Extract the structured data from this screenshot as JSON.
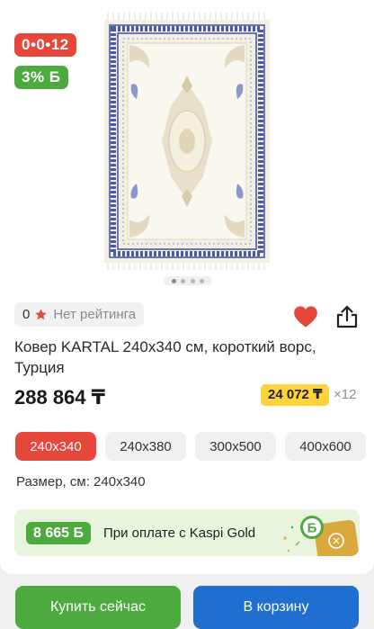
{
  "gallery": {
    "timer_badge": "0•0•12",
    "bonus_badge": "3% Б",
    "slide_count": 4,
    "active_slide": 0
  },
  "rating": {
    "value": "0",
    "label": "Нет рейтинга"
  },
  "product": {
    "title": "Ковер KARTAL 240х340 см, короткий ворс, Турция",
    "price": "288 864 ₸",
    "installment_price": "24 072 ₸",
    "installment_months": "×12"
  },
  "sizes": {
    "options": [
      "240х340",
      "240х380",
      "300х500",
      "400х600"
    ],
    "selected_index": 0,
    "selected_label": "Размер, см: 240х340"
  },
  "kaspi_gold": {
    "bonus": "8 665 Б",
    "text": "При оплате с Kaspi Gold"
  },
  "actions": {
    "buy_now": "Купить сейчас",
    "add_to_cart": "В корзину"
  },
  "colors": {
    "accent_red": "#e5473b",
    "kaspi_green": "#4caa3f",
    "cart_blue": "#1f6fd1",
    "installment_yellow": "#ffd43b",
    "rug_blue": "#3f4fa0",
    "rug_cream": "#f3efe3"
  },
  "icons": {
    "rating": "star-icon",
    "favorite": "heart-icon",
    "share": "share-icon"
  }
}
